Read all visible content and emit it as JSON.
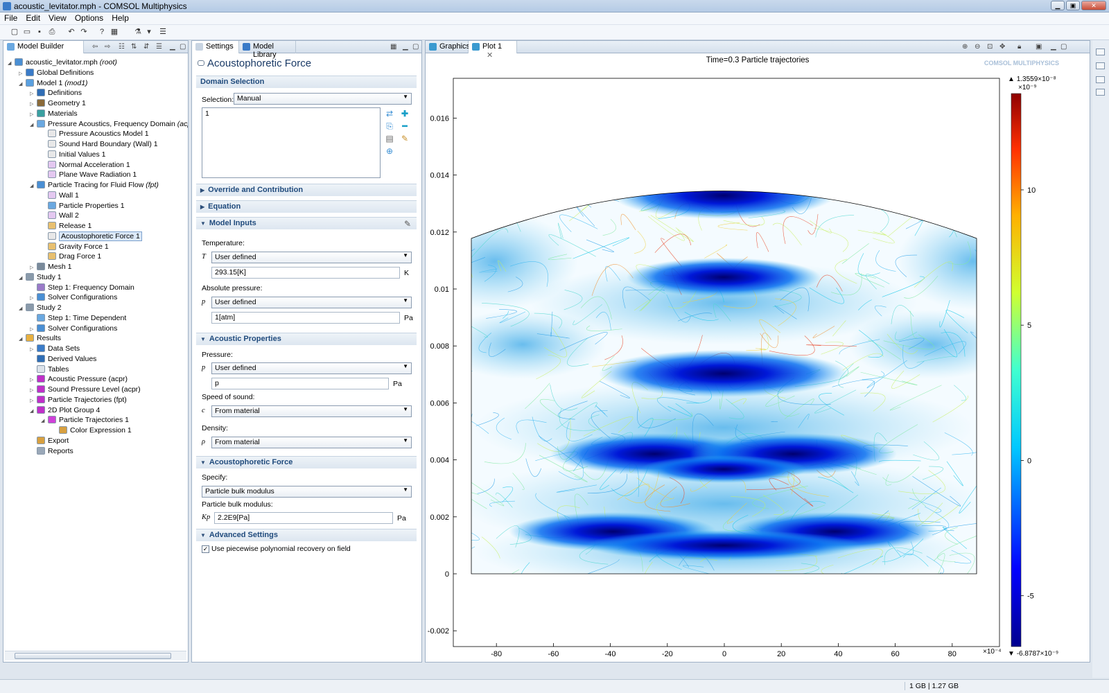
{
  "window": {
    "title": "acoustic_levitator.mph - COMSOL Multiphysics"
  },
  "menu": [
    "File",
    "Edit",
    "View",
    "Options",
    "Help"
  ],
  "model_builder": {
    "tab_label": "Model Builder",
    "tree": [
      {
        "label": "acoustic_levitator.mph",
        "suffix": "(root)",
        "depth": 0,
        "exp": "◢",
        "color": "#4a8fd4"
      },
      {
        "label": "Global Definitions",
        "depth": 1,
        "exp": "▷",
        "color": "#3a7bc8"
      },
      {
        "label": "Model 1",
        "suffix": "(mod1)",
        "depth": 1,
        "exp": "◢",
        "color": "#5aa0e0"
      },
      {
        "label": "Definitions",
        "depth": 2,
        "exp": "▷",
        "color": "#2f6db5"
      },
      {
        "label": "Geometry 1",
        "depth": 2,
        "exp": "▷",
        "color": "#8a6a3a"
      },
      {
        "label": "Materials",
        "depth": 2,
        "exp": "▷",
        "color": "#3aa0a0"
      },
      {
        "label": "Pressure Acoustics, Frequency Domain",
        "suffix": "(acpr)",
        "depth": 2,
        "exp": "◢",
        "color": "#6aa8e0"
      },
      {
        "label": "Pressure Acoustics Model 1",
        "depth": 3,
        "exp": "",
        "color": "#e8e8e8"
      },
      {
        "label": "Sound Hard Boundary (Wall) 1",
        "depth": 3,
        "exp": "",
        "color": "#e8e8e8"
      },
      {
        "label": "Initial Values 1",
        "depth": 3,
        "exp": "",
        "color": "#e8e8e8"
      },
      {
        "label": "Normal Acceleration 1",
        "depth": 3,
        "exp": "",
        "color": "#e4c8f0"
      },
      {
        "label": "Plane Wave Radiation 1",
        "depth": 3,
        "exp": "",
        "color": "#e4c8f0"
      },
      {
        "label": "Particle Tracing for Fluid Flow",
        "suffix": "(fpt)",
        "depth": 2,
        "exp": "◢",
        "color": "#4a8fd4"
      },
      {
        "label": "Wall 1",
        "depth": 3,
        "exp": "",
        "color": "#e4c8f0"
      },
      {
        "label": "Particle Properties 1",
        "depth": 3,
        "exp": "",
        "color": "#6aa8e0"
      },
      {
        "label": "Wall 2",
        "depth": 3,
        "exp": "",
        "color": "#e4c8f0"
      },
      {
        "label": "Release 1",
        "depth": 3,
        "exp": "",
        "color": "#e8c070"
      },
      {
        "label": "Acoustophoretic Force 1",
        "depth": 3,
        "exp": "",
        "color": "#e8e8e8",
        "selected": true
      },
      {
        "label": "Gravity Force 1",
        "depth": 3,
        "exp": "",
        "color": "#e8c070"
      },
      {
        "label": "Drag Force 1",
        "depth": 3,
        "exp": "",
        "color": "#e8c070"
      },
      {
        "label": "Mesh 1",
        "depth": 2,
        "exp": "▷",
        "color": "#7a8a9a"
      },
      {
        "label": "Study 1",
        "depth": 1,
        "exp": "◢",
        "color": "#8a9aaa"
      },
      {
        "label": "Step 1: Frequency Domain",
        "depth": 2,
        "exp": "",
        "color": "#9a7ac8"
      },
      {
        "label": "Solver Configurations",
        "depth": 2,
        "exp": "▷",
        "color": "#4a8fd4"
      },
      {
        "label": "Study 2",
        "depth": 1,
        "exp": "◢",
        "color": "#8a9aaa"
      },
      {
        "label": "Step 1: Time Dependent",
        "depth": 2,
        "exp": "",
        "color": "#6aa8e0"
      },
      {
        "label": "Solver Configurations",
        "depth": 2,
        "exp": "▷",
        "color": "#4a8fd4"
      },
      {
        "label": "Results",
        "depth": 1,
        "exp": "◢",
        "color": "#e8b040"
      },
      {
        "label": "Data Sets",
        "depth": 2,
        "exp": "▷",
        "color": "#3a7bc8"
      },
      {
        "label": "Derived Values",
        "depth": 2,
        "exp": "",
        "color": "#2f6db5"
      },
      {
        "label": "Tables",
        "depth": 2,
        "exp": "",
        "color": "#dde3ea"
      },
      {
        "label": "Acoustic Pressure (acpr)",
        "depth": 2,
        "exp": "▷",
        "color": "#c030c8"
      },
      {
        "label": "Sound Pressure Level (acpr)",
        "depth": 2,
        "exp": "▷",
        "color": "#c030c8"
      },
      {
        "label": "Particle Trajectories (fpt)",
        "depth": 2,
        "exp": "▷",
        "color": "#c030c8"
      },
      {
        "label": "2D Plot Group 4",
        "depth": 2,
        "exp": "◢",
        "color": "#c030c8"
      },
      {
        "label": "Particle Trajectories 1",
        "depth": 3,
        "exp": "◢",
        "color": "#d040d8"
      },
      {
        "label": "Color Expression 1",
        "depth": 4,
        "exp": "",
        "color": "#d8a040"
      },
      {
        "label": "Export",
        "depth": 2,
        "exp": "",
        "color": "#d8a040"
      },
      {
        "label": "Reports",
        "depth": 2,
        "exp": "",
        "color": "#9aa8b8"
      }
    ]
  },
  "settings": {
    "tab_label": "Settings",
    "library_tab": "Model Library",
    "title": "Acoustophoretic Force",
    "domain_selection": {
      "header": "Domain Selection",
      "selection_label": "Selection:",
      "selection_value": "Manual",
      "list_item": "1"
    },
    "override_header": "Override and Contribution",
    "equation_header": "Equation",
    "model_inputs": {
      "header": "Model Inputs",
      "temperature_label": "Temperature:",
      "temperature_symbol": "T",
      "temperature_source": "User defined",
      "temperature_value": "293.15[K]",
      "temperature_unit": "K",
      "pressure_label": "Absolute pressure:",
      "pressure_symbol": "p",
      "pressure_source": "User defined",
      "pressure_value": "1[atm]",
      "pressure_unit": "Pa"
    },
    "acoustic_properties": {
      "header": "Acoustic Properties",
      "pressure_label": "Pressure:",
      "pressure_symbol": "p",
      "pressure_source": "User defined",
      "pressure_value": "p",
      "pressure_unit": "Pa",
      "speed_label": "Speed of sound:",
      "speed_symbol": "c",
      "speed_source": "From material",
      "density_label": "Density:",
      "density_symbol": "ρ",
      "density_source": "From material"
    },
    "acoustophoretic_force": {
      "header": "Acoustophoretic Force",
      "specify_label": "Specify:",
      "specify_value": "Particle bulk modulus",
      "bulk_label": "Particle bulk modulus:",
      "bulk_symbol": "Kp",
      "bulk_value": "2.2E9[Pa]",
      "bulk_unit": "Pa"
    },
    "advanced": {
      "header": "Advanced Settings",
      "checkbox_label": "Use piecewise polynomial recovery on field",
      "checked": true
    }
  },
  "graphics": {
    "tab_graphics": "Graphics",
    "tab_plot": "Plot 1",
    "title": "Time=0.3  Particle trajectories",
    "watermark": "COMSOL MULTIPHYSICS",
    "colorbar_max": "1.3559×10⁻⁸",
    "colorbar_scale": "×10⁻⁹",
    "colorbar_min": "-6.8787×10⁻⁹",
    "colorbar_ticks": [
      "10",
      "5",
      "0",
      "-5"
    ],
    "x_ticks": [
      "-80",
      "-60",
      "-40",
      "-20",
      "0",
      "20",
      "40",
      "60",
      "80"
    ],
    "x_scale": "×10⁻⁴",
    "y_ticks": [
      "0.016",
      "0.014",
      "0.012",
      "0.01",
      "0.008",
      "0.006",
      "0.004",
      "0.002",
      "0",
      "-0.002"
    ]
  },
  "status": {
    "memory": "1 GB | 1.27 GB"
  },
  "colors": {
    "accent": "#1f4a7c",
    "selection": "#dce9f8"
  }
}
